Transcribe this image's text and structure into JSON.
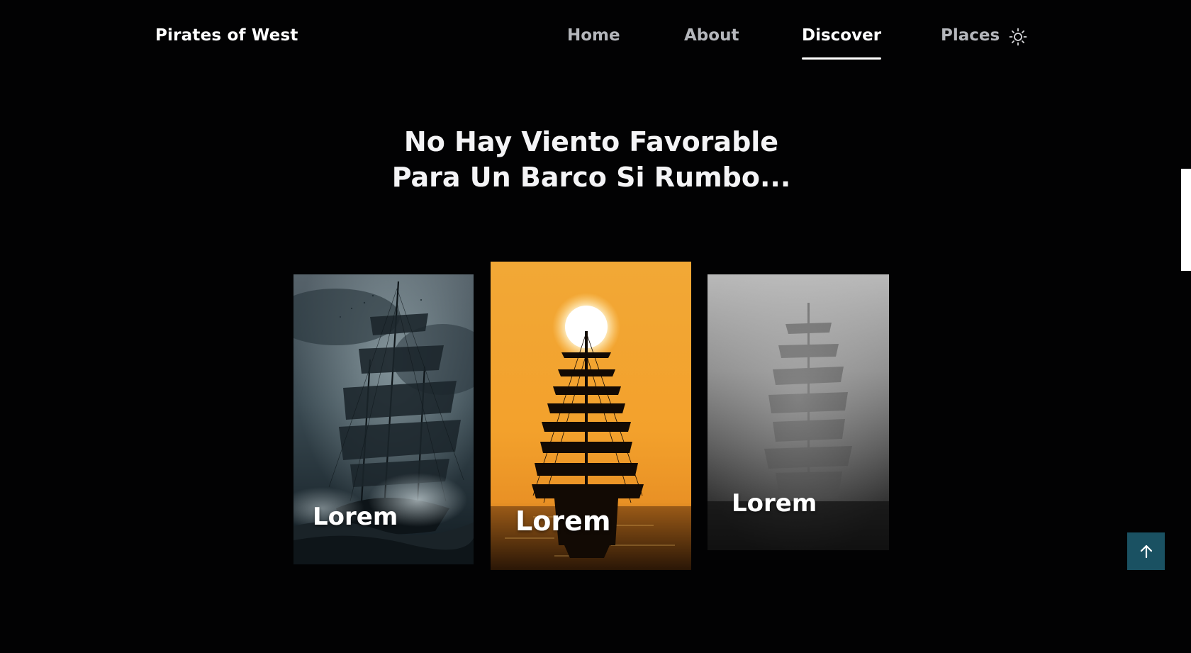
{
  "header": {
    "logo": "Pirates of West",
    "nav": [
      {
        "label": "Home",
        "active": false
      },
      {
        "label": "About",
        "active": false
      },
      {
        "label": "Discover",
        "active": true
      },
      {
        "label": "Places",
        "active": false
      }
    ],
    "theme_toggle_icon": "sun-icon"
  },
  "hero": {
    "title_line1": "No Hay Viento Favorable",
    "title_line2": "Para Un Barco Si Rumbo..."
  },
  "cards": [
    {
      "label": "Lorem",
      "image": "stormy-ship-image"
    },
    {
      "label": "Lorem",
      "image": "sunset-ship-silhouette-image"
    },
    {
      "label": "Lorem",
      "image": "foggy-ghost-ship-image"
    }
  ],
  "scroll_top": {
    "icon": "arrow-up-icon"
  },
  "colors": {
    "background": "#020203",
    "nav_inactive": "#b4b6bb",
    "nav_active": "#ffffff",
    "scroll_top_button": "#1a5162",
    "sunset_orange": "#f2a530"
  }
}
